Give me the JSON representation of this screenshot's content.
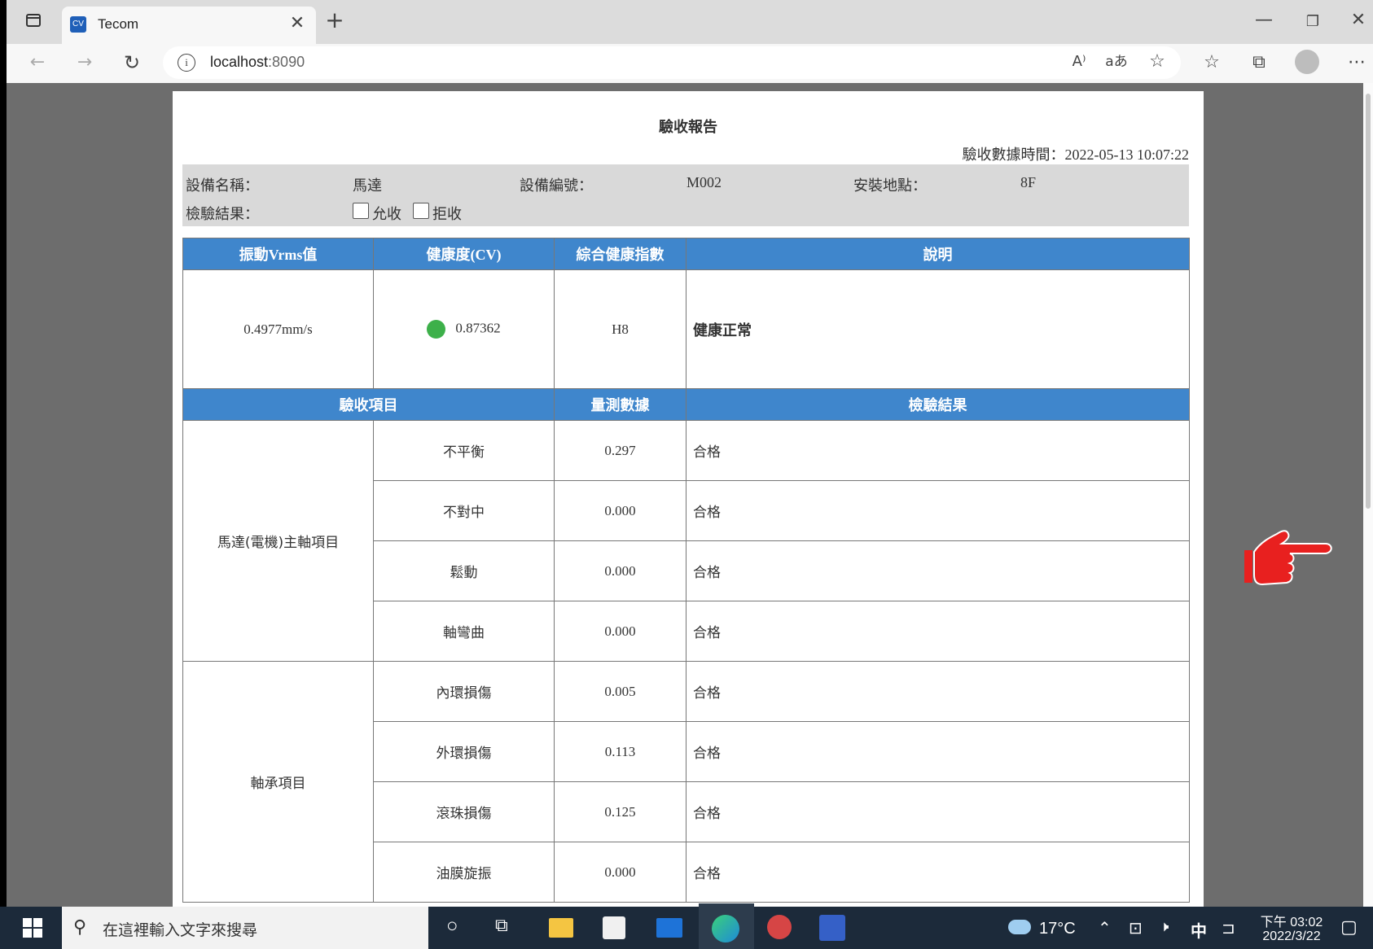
{
  "browser": {
    "tab_title": "Tecom",
    "tab_icon": "CV",
    "address": "localhost",
    "address_port": ":8090"
  },
  "report": {
    "title": "驗收報告",
    "time_label": "驗收數據時間：",
    "time_value": "2022-05-13 10:07:22",
    "device_name_label": "設備名稱：",
    "device_name": "馬達",
    "device_no_label": "設備編號：",
    "device_no": "M002",
    "location_label": "安裝地點：",
    "location": "8F",
    "result_label": "檢驗結果：",
    "accept_label": "允收",
    "reject_label": "拒收"
  },
  "summary": {
    "headers": [
      "振動Vrms值",
      "健康度(CV)",
      "綜合健康指數",
      "說明"
    ],
    "vrms": "0.4977mm/s",
    "cv": "0.87362",
    "cv_status_color": "#3db04a",
    "index": "H8",
    "note": "健康正常"
  },
  "items": {
    "headers": [
      "驗收項目",
      "量測數據",
      "檢驗結果"
    ],
    "groups": [
      {
        "name": "馬達(電機)主軸項目",
        "rows": [
          {
            "item": "不平衡",
            "value": "0.297",
            "result": "合格"
          },
          {
            "item": "不對中",
            "value": "0.000",
            "result": "合格"
          },
          {
            "item": "鬆動",
            "value": "0.000",
            "result": "合格"
          },
          {
            "item": "軸彎曲",
            "value": "0.000",
            "result": "合格"
          }
        ]
      },
      {
        "name": "軸承項目",
        "rows": [
          {
            "item": "內環損傷",
            "value": "0.005",
            "result": "合格"
          },
          {
            "item": "外環損傷",
            "value": "0.113",
            "result": "合格"
          },
          {
            "item": "滾珠損傷",
            "value": "0.125",
            "result": "合格"
          },
          {
            "item": "油膜旋振",
            "value": "0.000",
            "result": "合格"
          }
        ]
      }
    ]
  },
  "taskbar": {
    "search_placeholder": "在這裡輸入文字來搜尋",
    "weather": "17°C",
    "ime_lang": "中",
    "clock_time": "下午 03:02",
    "clock_date": "2022/3/22"
  },
  "colors": {
    "table_header": "#3f86cc",
    "pointer_hand": "#e8201f"
  }
}
